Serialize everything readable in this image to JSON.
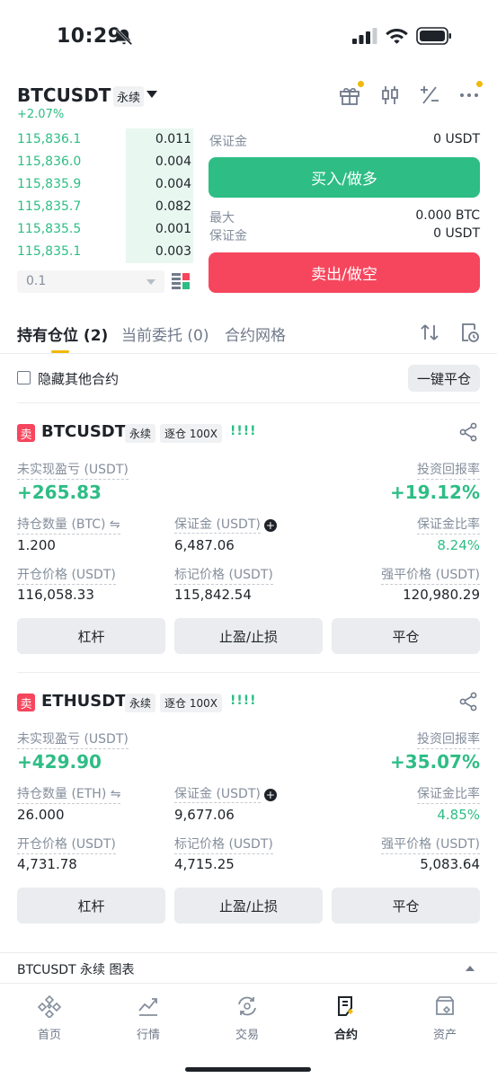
{
  "status": {
    "time": "10:29"
  },
  "header": {
    "pair": "BTCUSDT",
    "perp": "永续",
    "change": "+2.07%"
  },
  "orderbook": {
    "rows": [
      {
        "price": "115,836.1",
        "qty": "0.011"
      },
      {
        "price": "115,836.0",
        "qty": "0.004"
      },
      {
        "price": "115,835.9",
        "qty": "0.004"
      },
      {
        "price": "115,835.7",
        "qty": "0.082"
      },
      {
        "price": "115,835.5",
        "qty": "0.001"
      },
      {
        "price": "115,835.1",
        "qty": "0.003"
      }
    ],
    "depth": "0.1"
  },
  "trade": {
    "margin_label": "保证金",
    "buy_margin_value": "0 USDT",
    "buy_label": "买入/做多",
    "max_label": "最大",
    "max_value": "0.000 BTC",
    "sell_margin_label": "保证金",
    "sell_margin_value": "0 USDT",
    "sell_label": "卖出/做空"
  },
  "tabs": [
    {
      "label": "持有仓位 (2)"
    },
    {
      "label": "当前委托 (0)"
    },
    {
      "label": "合约网格"
    }
  ],
  "filter": {
    "hide_label": "隐藏其他合约",
    "close_all": "一键平仓"
  },
  "positions": [
    {
      "side": "卖",
      "symbol": "BTCUSDT",
      "perp": "永续",
      "mode": "逐仓 100X",
      "bars": "!!!!",
      "pnl_label": "未实现盈亏 (USDT)",
      "pnl": "+265.83",
      "roi_label": "投资回报率",
      "roi": "+19.12%",
      "size_label": "持仓数量 (BTC) ⇋",
      "size": "1.200",
      "margin_label": "保证金 (USDT)",
      "margin": "6,487.06",
      "ratio_label": "保证金比率",
      "ratio": "8.24%",
      "entry_label": "开仓价格 (USDT)",
      "entry": "116,058.33",
      "mark_label": "标记价格 (USDT)",
      "mark": "115,842.54",
      "liq_label": "强平价格 (USDT)",
      "liq": "120,980.29",
      "btn_leverage": "杠杆",
      "btn_tpsl": "止盈/止损",
      "btn_close": "平仓"
    },
    {
      "side": "卖",
      "symbol": "ETHUSDT",
      "perp": "永续",
      "mode": "逐仓 100X",
      "bars": "!!!!",
      "pnl_label": "未实现盈亏 (USDT)",
      "pnl": "+429.90",
      "roi_label": "投资回报率",
      "roi": "+35.07%",
      "size_label": "持仓数量 (ETH) ⇋",
      "size": "26.000",
      "margin_label": "保证金 (USDT)",
      "margin": "9,677.06",
      "ratio_label": "保证金比率",
      "ratio": "4.85%",
      "entry_label": "开仓价格 (USDT)",
      "entry": "4,731.78",
      "mark_label": "标记价格 (USDT)",
      "mark": "4,715.25",
      "liq_label": "强平价格 (USDT)",
      "liq": "5,083.64",
      "btn_leverage": "杠杆",
      "btn_tpsl": "止盈/止损",
      "btn_close": "平仓"
    }
  ],
  "chart_strip": {
    "label": "BTCUSDT 永续  图表"
  },
  "nav": [
    {
      "label": "首页",
      "icon": "home-icon"
    },
    {
      "label": "行情",
      "icon": "markets-icon"
    },
    {
      "label": "交易",
      "icon": "trade-icon"
    },
    {
      "label": "合约",
      "icon": "futures-icon"
    },
    {
      "label": "资产",
      "icon": "wallet-icon"
    }
  ],
  "colors": {
    "green": "#2ebd85",
    "red": "#f6465d",
    "accent": "#f0b90b",
    "text": "#1e2329"
  }
}
